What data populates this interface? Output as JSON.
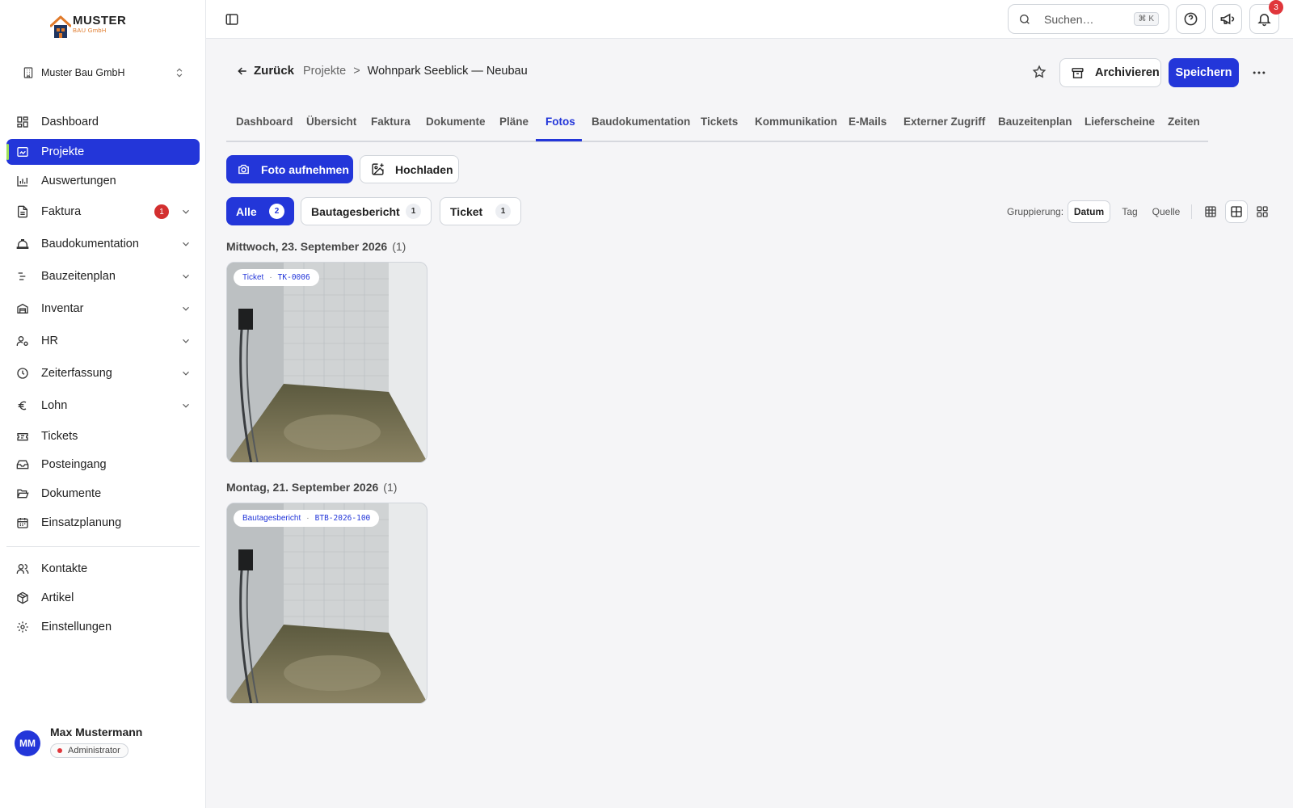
{
  "brand": {
    "name": "MUSTER",
    "sub": "BAU GmbH"
  },
  "company": {
    "name": "Muster Bau GmbH"
  },
  "sidebar": {
    "items": [
      {
        "label": "Dashboard"
      },
      {
        "label": "Projekte"
      },
      {
        "label": "Auswertungen"
      },
      {
        "label": "Faktura",
        "badge": "1"
      },
      {
        "label": "Baudokumentation"
      },
      {
        "label": "Bauzeitenplan"
      },
      {
        "label": "Inventar"
      },
      {
        "label": "HR"
      },
      {
        "label": "Zeiterfassung"
      },
      {
        "label": "Lohn"
      },
      {
        "label": "Tickets"
      },
      {
        "label": "Posteingang"
      },
      {
        "label": "Dokumente"
      },
      {
        "label": "Einsatzplanung"
      },
      {
        "label": "Kontakte"
      },
      {
        "label": "Artikel"
      },
      {
        "label": "Einstellungen"
      }
    ]
  },
  "user": {
    "initials": "MM",
    "name": "Max Mustermann",
    "role": "Administrator"
  },
  "topbar": {
    "search_placeholder": "Suchen…",
    "search_shortcut": "⌘ K",
    "notification_count": "3"
  },
  "header": {
    "back_label": "Zurück",
    "breadcrumb": {
      "parent": "Projekte",
      "separator": ">",
      "current": "Wohnpark Seeblick — Neubau"
    },
    "archive_label": "Archivieren",
    "save_label": "Speichern"
  },
  "tabs": [
    {
      "label": "Dashboard"
    },
    {
      "label": "Übersicht"
    },
    {
      "label": "Faktura"
    },
    {
      "label": "Dokumente"
    },
    {
      "label": "Pläne"
    },
    {
      "label": "Fotos",
      "active": true
    },
    {
      "label": "Baudokumentation"
    },
    {
      "label": "Tickets"
    },
    {
      "label": "Kommunikation"
    },
    {
      "label": "E-Mails"
    },
    {
      "label": "Externer Zugriff"
    },
    {
      "label": "Bauzeitenplan"
    },
    {
      "label": "Lieferscheine"
    },
    {
      "label": "Zeiten"
    }
  ],
  "actions": {
    "take_photo": "Foto aufnehmen",
    "upload": "Hochladen"
  },
  "filters": [
    {
      "label": "Alle",
      "count": "2",
      "active": true
    },
    {
      "label": "Bautagesbericht",
      "count": "1"
    },
    {
      "label": "Ticket",
      "count": "1"
    }
  ],
  "grouping": {
    "label": "Gruppierung:",
    "options": [
      "Datum",
      "Tag",
      "Quelle"
    ],
    "selected": "Datum"
  },
  "groups": [
    {
      "title": "Mittwoch, 23. September 2026",
      "count": "(1)",
      "photos": [
        {
          "type": "Ticket",
          "ref": "TK-0006"
        }
      ]
    },
    {
      "title": "Montag, 21. September 2026",
      "count": "(1)",
      "photos": [
        {
          "type": "Bautagesbericht",
          "ref": "BTB-2026-100"
        }
      ]
    }
  ],
  "colors": {
    "accent": "#2336d9",
    "badge": "#d32f2f",
    "active_marker": "#9ee05a",
    "brand_orange": "#e07a2a"
  }
}
